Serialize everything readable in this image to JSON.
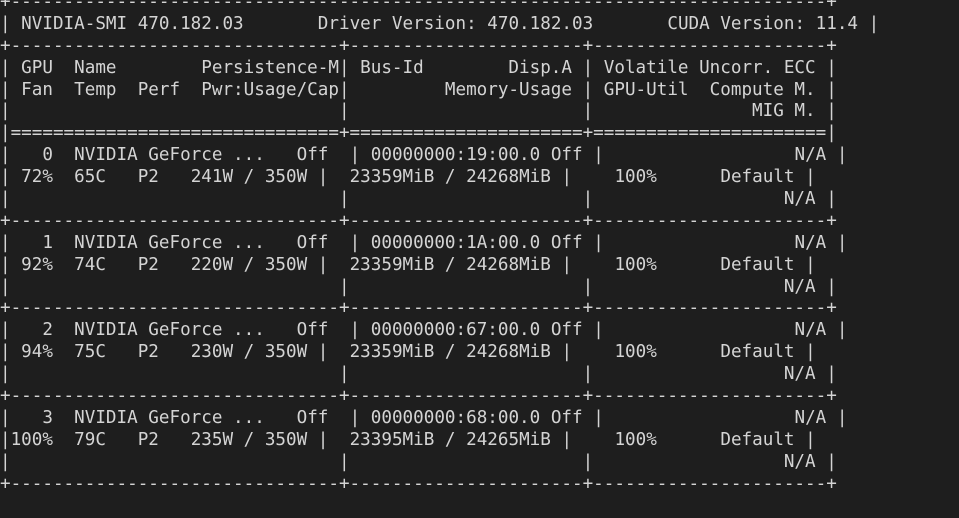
{
  "header": {
    "smi_version": "470.182.03",
    "driver_version": "470.182.03",
    "cuda_version": "11.4"
  },
  "columns": {
    "line1": "| GPU  Name        Persistence-M| Bus-Id        Disp.A | Volatile Uncorr. ECC |",
    "line2": "| Fan  Temp  Perf  Pwr:Usage/Cap|         Memory-Usage | GPU-Util  Compute M. |",
    "line3": "|                               |                      |               MIG M. |"
  },
  "gpus": [
    {
      "index": "0",
      "name": "NVIDIA GeForce ...",
      "persistence": "Off",
      "bus_id": "00000000:19:00.0",
      "disp": "Off",
      "ecc": "N/A",
      "fan": "72%",
      "temp": "65C",
      "perf": "P2",
      "pwr_usage": "241W",
      "pwr_cap": "350W",
      "mem_used": "23359MiB",
      "mem_total": "24268MiB",
      "util": "100%",
      "compute": "Default",
      "mig": "N/A"
    },
    {
      "index": "1",
      "name": "NVIDIA GeForce ...",
      "persistence": "Off",
      "bus_id": "00000000:1A:00.0",
      "disp": "Off",
      "ecc": "N/A",
      "fan": "92%",
      "temp": "74C",
      "perf": "P2",
      "pwr_usage": "220W",
      "pwr_cap": "350W",
      "mem_used": "23359MiB",
      "mem_total": "24268MiB",
      "util": "100%",
      "compute": "Default",
      "mig": "N/A"
    },
    {
      "index": "2",
      "name": "NVIDIA GeForce ...",
      "persistence": "Off",
      "bus_id": "00000000:67:00.0",
      "disp": "Off",
      "ecc": "N/A",
      "fan": "94%",
      "temp": "75C",
      "perf": "P2",
      "pwr_usage": "230W",
      "pwr_cap": "350W",
      "mem_used": "23359MiB",
      "mem_total": "24268MiB",
      "util": "100%",
      "compute": "Default",
      "mig": "N/A"
    },
    {
      "index": "3",
      "name": "NVIDIA GeForce ...",
      "persistence": "Off",
      "bus_id": "00000000:68:00.0",
      "disp": "Off",
      "ecc": "N/A",
      "fan": "100%",
      "temp": "79C",
      "perf": "P2",
      "pwr_usage": "235W",
      "pwr_cap": "350W",
      "mem_used": "23395MiB",
      "mem_total": "24265MiB",
      "util": "100%",
      "compute": "Default",
      "mig": "N/A"
    }
  ]
}
